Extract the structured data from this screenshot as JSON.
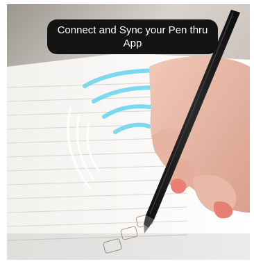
{
  "caption": {
    "text": "Connect and Sync your Pen thru App"
  },
  "scene": {
    "subject": "hand holding smart pen writing on notebook with wireless signal arcs",
    "colors": {
      "background": "#cfc9c3",
      "caption_bg": "#141414",
      "caption_text": "#ffffff",
      "signal": "#6fd6ee",
      "pen": "#1a1a1a",
      "skin": "#e8b7a6",
      "nails": "#e77f73",
      "notebook": "#f7f6f3",
      "ruled_lines": "#d9d4cf"
    }
  }
}
